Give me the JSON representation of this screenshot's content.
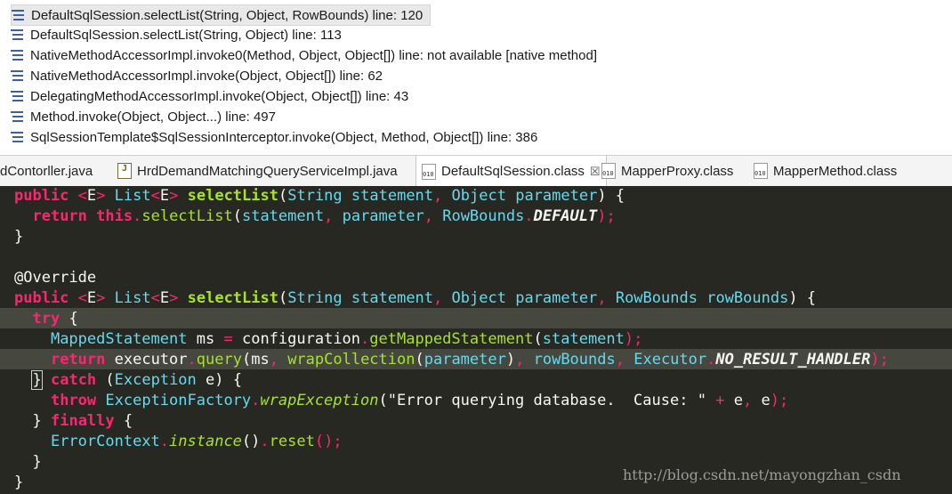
{
  "stack_frames": [
    {
      "text": "DefaultSqlSession.selectList(String, Object, RowBounds) line: 120",
      "selected": true
    },
    {
      "text": "DefaultSqlSession.selectList(String, Object) line: 113"
    },
    {
      "text": "NativeMethodAccessorImpl.invoke0(Method, Object, Object[]) line: not available [native method]"
    },
    {
      "text": "NativeMethodAccessorImpl.invoke(Object, Object[]) line: 62"
    },
    {
      "text": "DelegatingMethodAccessorImpl.invoke(Object, Object[]) line: 43"
    },
    {
      "text": "Method.invoke(Object, Object...) line: 497"
    },
    {
      "text": "SqlSessionTemplate$SqlSessionInterceptor.invoke(Object, Method, Object[]) line: 386"
    }
  ],
  "tabs": [
    {
      "label": "dContorller.java",
      "icon": "java-file-icon"
    },
    {
      "label": "HrdDemandMatchingQueryServiceImpl.java",
      "icon": "java-file-icon"
    },
    {
      "label": "DefaultSqlSession.class",
      "icon": "class-file-icon",
      "active": true,
      "close": "☒"
    },
    {
      "label": "MapperProxy.class",
      "icon": "class-file-icon"
    },
    {
      "label": "MapperMethod.class",
      "icon": "class-file-icon"
    }
  ],
  "code": {
    "l1": {
      "kw_public": "public",
      "lt": "<",
      "E": "E",
      "gt": ">",
      "List": "List",
      "lt2": "<",
      "E2": "E",
      "gt2": ">",
      "name": "selectList",
      "p1": "(",
      "String": "String",
      "statement": "statement",
      "c1": ",",
      "Object": "Object",
      "parameter": "parameter",
      "close": ") {"
    },
    "l2": {
      "return": "return",
      "this": "this",
      "dot": ".",
      "call": "selectList",
      "p": "(",
      "a1": "statement",
      "c1": ",",
      "a2": "parameter",
      "c2": ",",
      "a3": "RowBounds",
      "dot2": ".",
      "a4": "DEFAULT",
      "end": ");"
    },
    "l3": "}",
    "l5": "@Override",
    "l6": {
      "kw_public": "public",
      "lt": "<",
      "E": "E",
      "gt": ">",
      "List": "List",
      "lt2": "<",
      "E2": "E",
      "gt2": ">",
      "name": "selectList",
      "p1": "(",
      "String": "String",
      "statement": "statement",
      "c1": ",",
      "Object": "Object",
      "parameter": "parameter",
      "c2": ",",
      "RowBounds": "RowBounds",
      "rowBounds": "rowBounds",
      "close": ") {"
    },
    "l7": {
      "try": "try",
      "brace": " {"
    },
    "l8": {
      "type": "MappedStatement",
      "var": "ms",
      "eq": "=",
      "obj": "configuration",
      "dot": ".",
      "call": "getMappedStatement",
      "p": "(",
      "arg": "statement",
      "end": ");"
    },
    "l9": {
      "return": "return",
      "obj": "executor",
      "dot": ".",
      "call": "query",
      "p": "(",
      "a1": "ms",
      "c1": ",",
      "wrap": "wrapCollection",
      "p2": "(",
      "a2": "parameter",
      "p3": ")",
      "c2": ",",
      "a3": "rowBounds",
      "c3": ",",
      "a4": "Executor",
      "dot2": ".",
      "a5": "NO_RESULT_HANDLER",
      "end": ");"
    },
    "l10": {
      "brace": "}",
      "catch": "catch",
      "p": " (",
      "type": "Exception",
      "var": " e",
      "close": ") {"
    },
    "l11": {
      "throw": "throw",
      "cls": "ExceptionFactory",
      "dot": ".",
      "call": "wrapException",
      "p": "(",
      "str": "\"Error querying database.  Cause: \"",
      "plus": "+",
      "a1": "e",
      "c1": ",",
      "a2": "e",
      "end": ");"
    },
    "l12": {
      "brace": "}",
      "finally": "finally",
      "open": " {"
    },
    "l13": {
      "cls": "ErrorContext",
      "dot": ".",
      "call": "instance",
      "p": "()",
      "dot2": ".",
      "call2": "reset",
      "end": "();"
    },
    "l14": "}",
    "l15": "}"
  },
  "watermark": "http://blog.csdn.net/mayongzhan_csdn"
}
